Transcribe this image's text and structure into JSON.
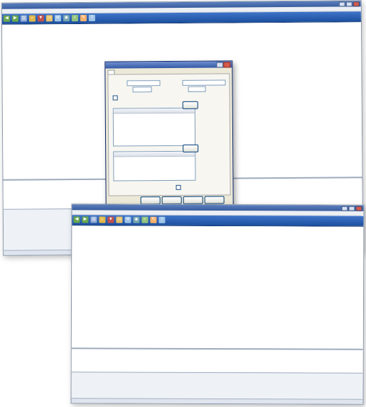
{
  "window1": {
    "title": "",
    "menu": [],
    "brand": "",
    "toolbar_icons": [
      "back-icon",
      "forward-icon",
      "print-icon",
      "search-icon",
      "filter-icon",
      "folder-icon",
      "mail-icon",
      "camera-icon",
      "check-icon",
      "edit-icon",
      "help-icon"
    ],
    "columns": [],
    "rows": [],
    "lower_columns": [],
    "lower_rows": [],
    "detail_rows": [],
    "status": ""
  },
  "dialog": {
    "title": "",
    "tab": "",
    "section_label": "",
    "fields": [],
    "checkbox_label": "",
    "list1_header": "",
    "list1_button": "",
    "list2_header": "",
    "list2_button": "",
    "bottom_checkbox_label": "",
    "buttons": []
  },
  "window2": {
    "title": "",
    "menu": [],
    "brand": "",
    "toolbar_icons": [
      "back-icon",
      "forward-icon",
      "print-icon",
      "search-icon",
      "filter-icon",
      "folder-icon",
      "mail-icon",
      "camera-icon",
      "check-icon",
      "edit-icon",
      "help-icon"
    ],
    "columns": [],
    "rows": [],
    "lower_columns": [],
    "lower_rows": [],
    "detail_rows": [],
    "status": ""
  }
}
